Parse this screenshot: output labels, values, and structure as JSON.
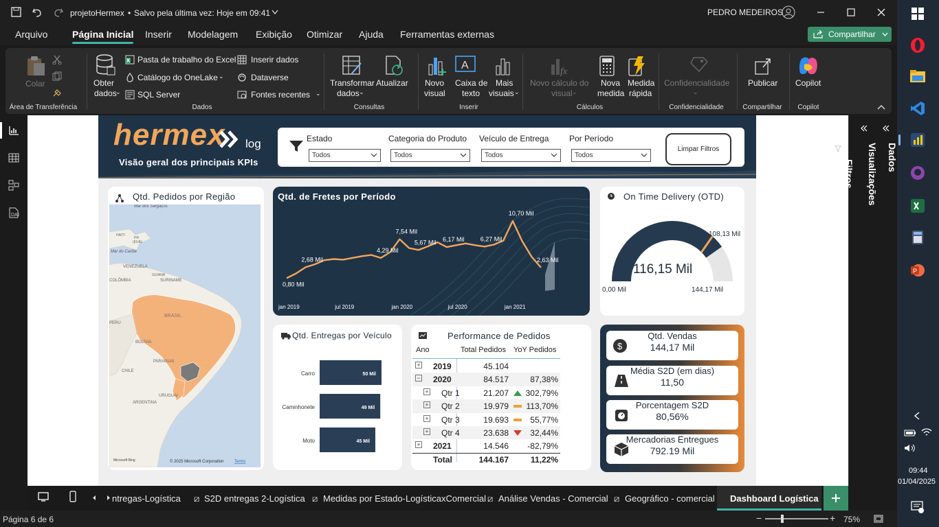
{
  "app": {
    "title": "projetoHermex",
    "save_status": "Salvo pela última vez: Hoje em 09:41",
    "user": "PEDRO MEDEIROS"
  },
  "menu": [
    "Arquivo",
    "Página Inicial",
    "Inserir",
    "Modelagem",
    "Exibição",
    "Otimizar",
    "Ajuda",
    "Ferramentas externas"
  ],
  "share": "Compartilhar",
  "ribbon": {
    "colar": "Colar",
    "area": "Área de Transferência",
    "obter1": "Obter",
    "obter2": "dados",
    "excel": "Pasta de trabalho do Excel",
    "onelake": "Catálogo do OneLake",
    "sql": "SQL Server",
    "inserir_dados": "Inserir dados",
    "dataverse": "Dataverse",
    "fontes": "Fontes recentes",
    "dados": "Dados",
    "transformar1": "Transformar",
    "transformar2": "dados",
    "atualizar": "Atualizar",
    "consultas": "Consultas",
    "novo1": "Novo",
    "novo2": "visual",
    "caixa1": "Caixa de",
    "caixa2": "texto",
    "mais1": "Mais",
    "mais2": "visuais",
    "inserir": "Inserir",
    "novo_calc1": "Novo cálculo do",
    "novo_calc2": "visual",
    "nova_medida1": "Nova",
    "nova_medida2": "medida",
    "medida_rapida1": "Medida",
    "medida_rapida2": "rápida",
    "calculos": "Cálculos",
    "conf": "Confidencialidade",
    "conf_grp": "Confidencialidade",
    "publicar": "Publicar",
    "compartilhar": "Compartilhar",
    "copilot": "Copilot",
    "copilot_grp": "Copilot"
  },
  "header": {
    "logo_main": "hermex",
    "logo_sub": "log",
    "subtitle": "Visão geral dos principais KPIs",
    "filters": [
      {
        "label": "Estado",
        "value": "Todos"
      },
      {
        "label": "Categoria do Produto",
        "value": "Todos"
      },
      {
        "label": "Veículo de Entrega",
        "value": "Todos"
      },
      {
        "label": "Por Período",
        "value": "Todos"
      }
    ],
    "clear": "Limpar Filtros"
  },
  "map": {
    "title": "Qtd. Pedidos por Região",
    "labels": {
      "sargasso": "Mar dos Sargaços",
      "caribe": "Mar do Caribe",
      "venezuela": "VENEZUELA",
      "guiana": "GUIANA",
      "suriname": "SURINAME",
      "colombia": "COLÔMBIA",
      "brasil": "BRASIL",
      "peru": "PERU",
      "bolivia": "BOLÍVIA",
      "paraguai": "PARAGUAI",
      "uruguai": "URUGUAI",
      "argentina": "ARGENTINA",
      "chile": "CHILE",
      "pr": "PR",
      "eua": "(EUA)",
      "haiti": "HAITI"
    },
    "attribution": "© 2025 Microsoft Corporation",
    "terms": "Terms",
    "bing": "Microsoft Bing"
  },
  "line": {
    "title": "Qtd. de Fretes por Período"
  },
  "otd": {
    "title": "On Time Delivery (OTD)",
    "value": "116,15 Mil",
    "target": "108,13 Mil",
    "min": "0,00 Mil",
    "max": "144,17 Mil",
    "fraction": 0.8057
  },
  "vehicle": {
    "title": "Qtd. Entregas por Veículo"
  },
  "perf": {
    "title": "Performance de Pedidos",
    "headers": [
      "Ano",
      "Total Pedidos",
      "YoY Pedidos"
    ],
    "rows": [
      {
        "toggle": "+",
        "label": "2019",
        "total": "45.104",
        "yoy": "",
        "trend": "",
        "bold": true
      },
      {
        "toggle": "−",
        "label": "2020",
        "total": "84.517",
        "yoy": "87,38%",
        "trend": "",
        "bold": true
      },
      {
        "toggle": "+",
        "label": "Qtr 1",
        "total": "21.207",
        "yoy": "302,79%",
        "trend": "up",
        "bold": false
      },
      {
        "toggle": "+",
        "label": "Qtr 2",
        "total": "19.979",
        "yoy": "113,70%",
        "trend": "flat",
        "bold": false
      },
      {
        "toggle": "+",
        "label": "Qtr 3",
        "total": "19.693",
        "yoy": "55,77%",
        "trend": "flat",
        "bold": false
      },
      {
        "toggle": "+",
        "label": "Qtr 4",
        "total": "23.638",
        "yoy": "32,44%",
        "trend": "down",
        "bold": false
      },
      {
        "toggle": "+",
        "label": "2021",
        "total": "14.546",
        "yoy": "-82,79%",
        "trend": "",
        "bold": true
      }
    ],
    "total_label": "Total",
    "total_value": "144.167",
    "total_yoy": "11,22%"
  },
  "kpis": [
    {
      "label": "Qtd. Vendas",
      "value": "144,17 Mil"
    },
    {
      "label": "Média S2D (em dias)",
      "value": "11,50"
    },
    {
      "label": "Porcentagem S2D",
      "value": "80,56%"
    },
    {
      "label": "Mercadorias Entregues",
      "value": "792.19 Mil"
    }
  ],
  "panes": {
    "filtros": "Filtros",
    "visualizacoes": "Visualizações",
    "dados": "Dados"
  },
  "tabs": [
    "ntregas-Logística",
    "S2D entregas 2-Logística",
    "Medidas por Estado-LogísticaxComercial",
    "Análise Vendas - Comercial",
    "Geográfico - comercial",
    "Dashboard Logística"
  ],
  "status": {
    "page": "Página 6 de 6",
    "zoom": "75%"
  },
  "clock": {
    "time": "09:44",
    "date": "01/04/2025"
  },
  "colors": {
    "accent": "#3fb6a8",
    "navy": "#1f3347",
    "orange": "#f2a65a",
    "share": "#3a8f6a"
  },
  "chart_data": [
    {
      "type": "line",
      "title": "Qtd. de Fretes por Período",
      "unit": "Mil",
      "x_ticks": [
        "jan 2019",
        "jul 2019",
        "jan 2020",
        "jul 2020",
        "jan 2021"
      ],
      "labeled_points": [
        {
          "x": "jan 2019",
          "y": 0.8,
          "label": "0,80 Mil"
        },
        {
          "x": "mar 2019",
          "y": 2.68,
          "label": "2,68 Mil"
        },
        {
          "x": "nov 2019",
          "y": 4.29,
          "label": "4,29 Mil"
        },
        {
          "x": "jan 2020",
          "y": 7.54,
          "label": "7,54 Mil"
        },
        {
          "x": "mar 2020",
          "y": 5.67,
          "label": "5,67 Mil"
        },
        {
          "x": "jun 2020",
          "y": 6.17,
          "label": "6,17 Mil"
        },
        {
          "x": "set 2020",
          "y": 6.27,
          "label": "6,27 Mil"
        },
        {
          "x": "dez 2020",
          "y": 10.7,
          "label": "10,70 Mil"
        },
        {
          "x": "mar 2021",
          "y": 2.63,
          "label": "2,63 Mil"
        }
      ],
      "series": [
        {
          "values": [
            0.8,
            1.6,
            2.68,
            3.2,
            3.9,
            4.1,
            4.0,
            4.3,
            4.6,
            4.8,
            4.29,
            5.3,
            7.54,
            6.0,
            5.67,
            6.3,
            7.0,
            6.17,
            6.5,
            6.8,
            6.5,
            6.27,
            6.6,
            7.3,
            10.7,
            7.2,
            4.5,
            2.63
          ]
        }
      ]
    },
    {
      "type": "bar",
      "title": "Qtd. Entregas por Veículo",
      "orientation": "horizontal",
      "categories": [
        "Carro",
        "Caminhonete",
        "Moto"
      ],
      "values": [
        50,
        49,
        45
      ],
      "value_labels": [
        "50 Mil",
        "49 Mil",
        "45 Mil"
      ]
    }
  ]
}
